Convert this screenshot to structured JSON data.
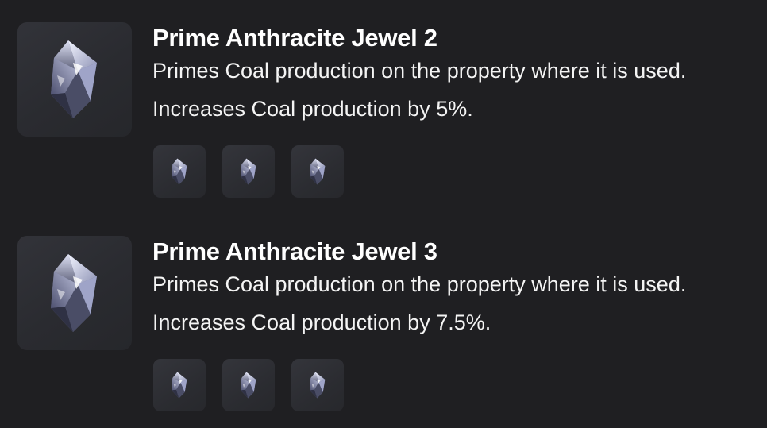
{
  "items": [
    {
      "title": "Prime Anthracite Jewel 2",
      "description": "Primes Coal production on the property where it is used.",
      "effect": "Increases Coal production by 5%.",
      "icon": "anthracite-jewel-icon",
      "slots": [
        {
          "icon": "anthracite-jewel-icon"
        },
        {
          "icon": "anthracite-jewel-icon"
        },
        {
          "icon": "anthracite-jewel-icon"
        }
      ]
    },
    {
      "title": "Prime Anthracite Jewel 3",
      "description": "Primes Coal production on the property where it is used.",
      "effect": "Increases Coal production by 7.5%.",
      "icon": "anthracite-jewel-icon",
      "slots": [
        {
          "icon": "anthracite-jewel-icon"
        },
        {
          "icon": "anthracite-jewel-icon"
        },
        {
          "icon": "anthracite-jewel-icon"
        }
      ]
    }
  ],
  "colors": {
    "background": "#1f1f22",
    "tile": "#2c2d32",
    "text": "#ffffff"
  }
}
